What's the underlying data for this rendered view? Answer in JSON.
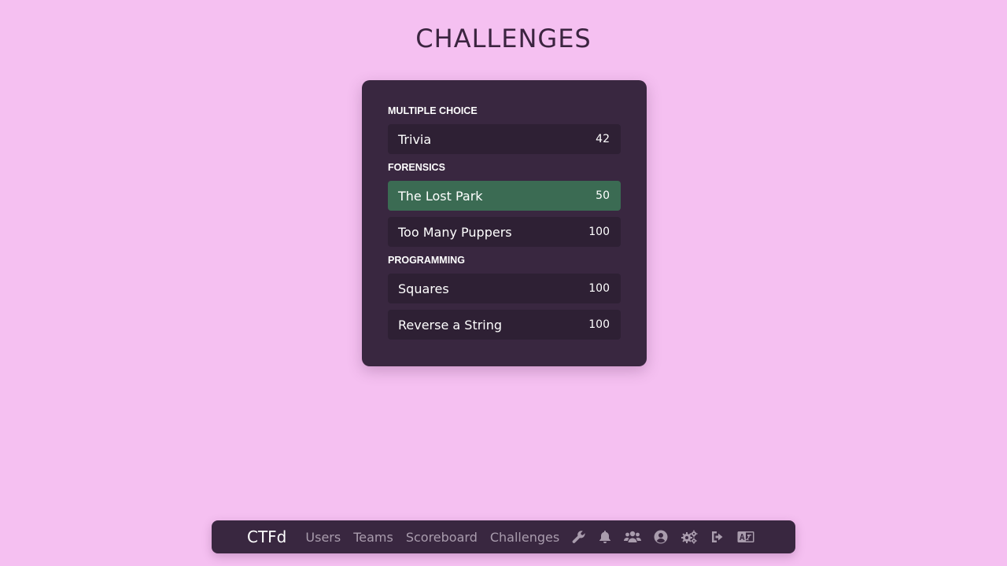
{
  "page": {
    "title": "CHALLENGES"
  },
  "categories": [
    {
      "name": "MULTIPLE CHOICE",
      "challenges": [
        {
          "name": "Trivia",
          "value": "42",
          "solved": false
        }
      ]
    },
    {
      "name": "FORENSICS",
      "challenges": [
        {
          "name": "The Lost Park",
          "value": "50",
          "solved": true
        },
        {
          "name": "Too Many Puppers",
          "value": "100",
          "solved": false
        }
      ]
    },
    {
      "name": "PROGRAMMING",
      "challenges": [
        {
          "name": "Squares",
          "value": "100",
          "solved": false
        },
        {
          "name": "Reverse a String",
          "value": "100",
          "solved": false
        }
      ]
    }
  ],
  "navbar": {
    "brand": "CTFd",
    "links": [
      "Users",
      "Teams",
      "Scoreboard",
      "Challenges"
    ],
    "icons": [
      "wrench-icon",
      "bell-icon",
      "users-icon",
      "user-circle-icon",
      "cogs-icon",
      "sign-out-icon",
      "language-icon"
    ]
  },
  "colors": {
    "background": "#f5c0f1",
    "panel": "#392740",
    "challenge": "#2e2034",
    "solved": "#3b6b53",
    "nav_link": "#a99cad"
  }
}
